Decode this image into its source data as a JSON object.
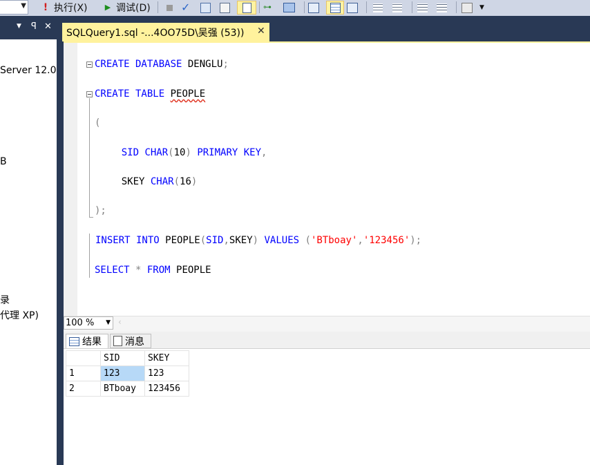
{
  "toolbar": {
    "execute_label": "执行(X)",
    "debug_label": "调试(D)"
  },
  "left_panel": {
    "items": [
      {
        "text": "Server 12.0"
      },
      {
        "text": "B"
      },
      {
        "text": "录"
      },
      {
        "text": "代理 XP)"
      }
    ]
  },
  "doc_tab": {
    "title": "SQLQuery1.sql -...4OO75D\\吴强 (53))",
    "close": "✕"
  },
  "editor": {
    "lines": [
      [
        {
          "t": "CREATE DATABASE",
          "c": "kw"
        },
        {
          "t": " DENGLU",
          "c": "bk"
        },
        {
          "t": ";",
          "c": "gr"
        }
      ],
      [
        {
          "t": "CREATE TABLE",
          "c": "kw"
        },
        {
          "t": " ",
          "c": "bk"
        },
        {
          "t": "PEOPLE",
          "c": "bk",
          "squiggle": true
        }
      ],
      [
        {
          "t": "(",
          "c": "gr"
        }
      ],
      [
        {
          "t": "    SID ",
          "c": "kw"
        },
        {
          "t": "CHAR",
          "c": "kw"
        },
        {
          "t": "(",
          "c": "gr"
        },
        {
          "t": "10",
          "c": "bk"
        },
        {
          "t": ")",
          "c": "gr"
        },
        {
          "t": " PRIMARY KEY",
          "c": "kw"
        },
        {
          "t": ",",
          "c": "gr"
        }
      ],
      [
        {
          "t": "    SKEY ",
          "c": "bk"
        },
        {
          "t": "CHAR",
          "c": "kw"
        },
        {
          "t": "(",
          "c": "gr"
        },
        {
          "t": "16",
          "c": "bk"
        },
        {
          "t": ")",
          "c": "gr"
        }
      ],
      [
        {
          "t": ");",
          "c": "gr"
        }
      ],
      [
        {
          "t": "INSERT INTO",
          "c": "kw"
        },
        {
          "t": " PEOPLE",
          "c": "bk"
        },
        {
          "t": "(",
          "c": "gr"
        },
        {
          "t": "SID",
          "c": "kw"
        },
        {
          "t": ",",
          "c": "gr"
        },
        {
          "t": "SKEY",
          "c": "bk"
        },
        {
          "t": ")",
          "c": "gr"
        },
        {
          "t": " VALUES ",
          "c": "kw"
        },
        {
          "t": "(",
          "c": "gr"
        },
        {
          "t": "'BTboay'",
          "c": "st"
        },
        {
          "t": ",",
          "c": "gr"
        },
        {
          "t": "'123456'",
          "c": "st"
        },
        {
          "t": ");",
          "c": "gr"
        }
      ],
      [
        {
          "t": "SELECT",
          "c": "kw"
        },
        {
          "t": " * ",
          "c": "gr"
        },
        {
          "t": "FROM",
          "c": "kw"
        },
        {
          "t": " PEOPLE",
          "c": "bk"
        }
      ]
    ]
  },
  "zoom": {
    "value": "100 %"
  },
  "result_tabs": [
    {
      "label": "结果"
    },
    {
      "label": "消息"
    }
  ],
  "results": {
    "columns": [
      "SID",
      "SKEY"
    ],
    "rows": [
      {
        "n": "1",
        "cells": [
          "123",
          "123"
        ]
      },
      {
        "n": "2",
        "cells": [
          "BTboay",
          "123456"
        ]
      }
    ]
  }
}
